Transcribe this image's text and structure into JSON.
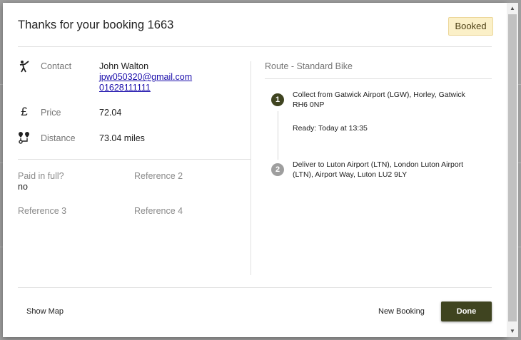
{
  "dialog": {
    "title": "Thanks for your booking 1663",
    "status_badge": "Booked"
  },
  "details": {
    "contact": {
      "icon": "person-waving-icon",
      "label": "Contact",
      "name": "John Walton",
      "email": "jpw050320@gmail.com",
      "phone": "01628111111"
    },
    "price": {
      "icon": "pound-icon",
      "label": "Price",
      "value": "72.04"
    },
    "distance": {
      "icon": "route-pins-icon",
      "label": "Distance",
      "value": "73.04 miles"
    }
  },
  "fields": {
    "paid_label": "Paid in full?",
    "paid_value": "no",
    "ref2_label": "Reference 2",
    "ref3_label": "Reference 3",
    "ref4_label": "Reference 4"
  },
  "route": {
    "title": "Route - Standard Bike",
    "steps": [
      {
        "number": "1",
        "text": "Collect from Gatwick Airport (LGW), Horley, Gatwick RH6 0NP",
        "note": "Ready: Today at 13:35",
        "color": "#3f4420"
      },
      {
        "number": "2",
        "text": "Deliver to Luton Airport (LTN), London Luton Airport (LTN), Airport Way, Luton LU2 9LY",
        "color": "#9e9e9e"
      }
    ]
  },
  "actions": {
    "show_map": "Show Map",
    "new_booking": "New Booking",
    "done": "Done"
  },
  "colors": {
    "accent": "#3f4420",
    "badge_bg": "#fbf0c8",
    "link": "#1a0dab"
  }
}
